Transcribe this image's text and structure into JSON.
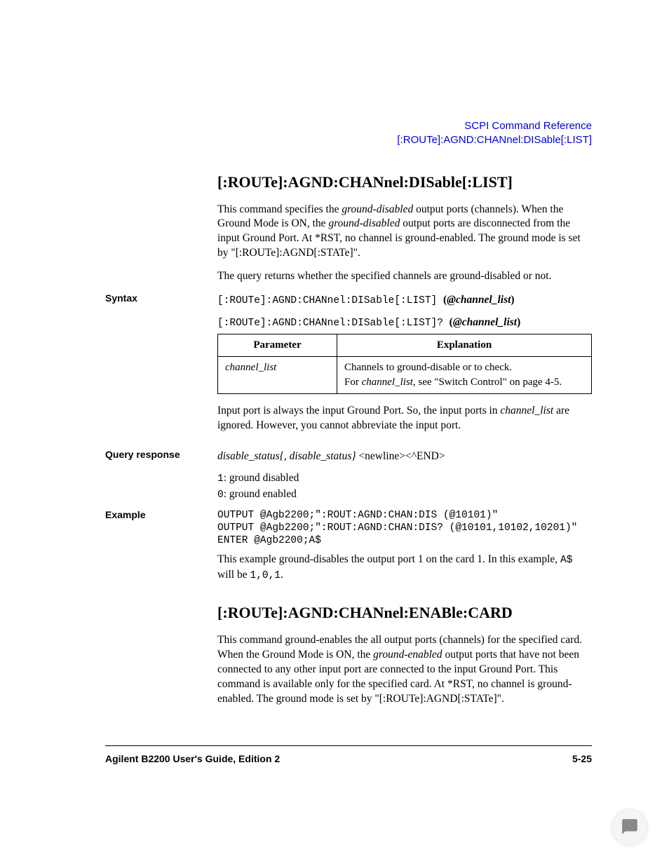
{
  "header": {
    "line1": "SCPI Command Reference",
    "line2": "[:ROUTe]:AGND:CHANnel:DISable[:LIST]"
  },
  "section1": {
    "title": "[:ROUTe]:AGND:CHANnel:DISable[:LIST]",
    "desc1_a": "This command specifies the ",
    "desc1_em1": "ground-disabled",
    "desc1_b": " output ports (channels). When the Ground Mode is ON, the ",
    "desc1_em2": "ground-disabled",
    "desc1_c": " output ports are disconnected from the input Ground Port. At *RST, no channel is ground-enabled. The ground mode is set by \"[:ROUTe]:AGND[:STATe]\".",
    "desc2": "The query returns whether the specified channels are ground-disabled or not."
  },
  "syntax": {
    "label": "Syntax",
    "cmd1_mono": "[:ROUTe]:AGND:CHANnel:DISable[:LIST] ",
    "cmd1_boldital": "(@channel_list)",
    "cmd2_mono": "[:ROUTe]:AGND:CHANnel:DISable[:LIST]? ",
    "cmd2_boldital": "(@channel_list)",
    "table": {
      "h1": "Parameter",
      "h2": "Explanation",
      "param": "channel_list",
      "expl_a": "Channels to ground-disable or to check.",
      "expl_b1": "For ",
      "expl_b_em": "channel_list",
      "expl_b2": ", see \"Switch Control\" on page 4-5."
    },
    "note_a": "Input port is always the input Ground Port. So, the input ports in ",
    "note_em": "channel_list",
    "note_b": " are ignored. However, you cannot abbreviate the input port."
  },
  "query": {
    "label": "Query response",
    "resp_em": "disable_status{, disable_status}",
    "resp_tail": " <newline><^END>",
    "line1_code": "1",
    "line1_text": ": ground disabled",
    "line2_code": "0",
    "line2_text": ": ground enabled"
  },
  "example": {
    "label": "Example",
    "code": "OUTPUT @Agb2200;\":ROUT:AGND:CHAN:DIS (@10101)\"\nOUTPUT @Agb2200;\":ROUT:AGND:CHAN:DIS? (@10101,10102,10201)\"\nENTER @Agb2200;A$",
    "note_a": "This example ground-disables the output port 1 on the card 1. In this example, ",
    "note_code1": "A$",
    "note_b": " will be ",
    "note_code2": "1,0,1",
    "note_c": "."
  },
  "section2": {
    "title": "[:ROUTe]:AGND:CHANnel:ENABle:CARD",
    "desc_a": "This command ground-enables the all output ports (channels) for the specified card. When the Ground Mode is ON, the ",
    "desc_em": "ground-enabled",
    "desc_b": " output ports that have not been connected to any other input port are connected to the input Ground Port. This command is available only for the specified card. At *RST, no channel is ground-enabled. The ground mode is set by \"[:ROUTe]:AGND[:STATe]\"."
  },
  "footer": {
    "left": "Agilent B2200 User's Guide, Edition 2",
    "right": "5-25"
  }
}
